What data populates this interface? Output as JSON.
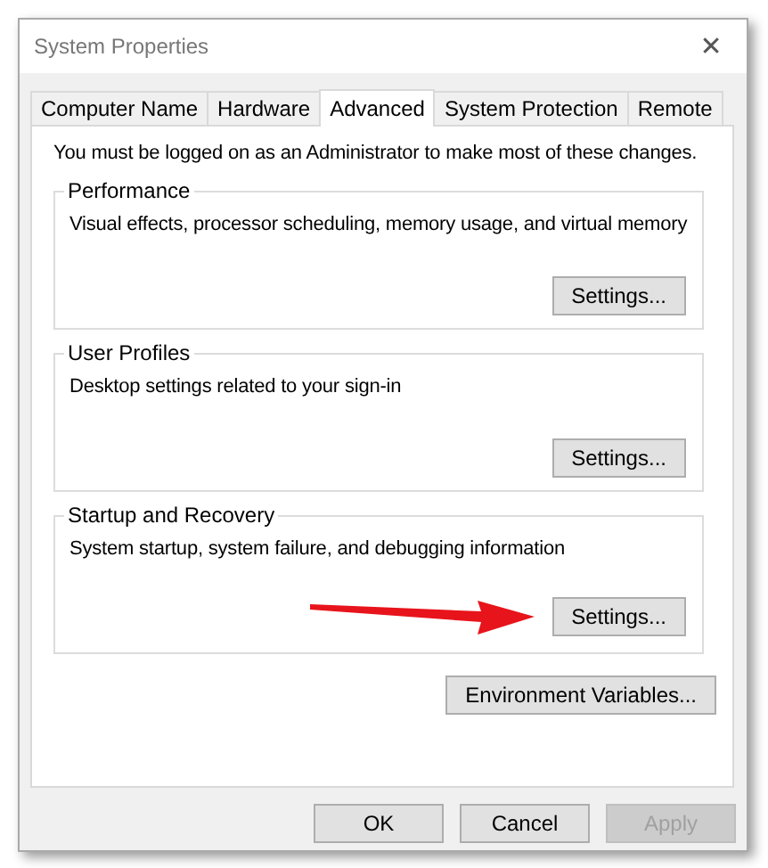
{
  "window": {
    "title": "System Properties",
    "close": "✕"
  },
  "tabs": [
    {
      "label": "Computer Name",
      "selected": false
    },
    {
      "label": "Hardware",
      "selected": false
    },
    {
      "label": "Advanced",
      "selected": true
    },
    {
      "label": "System Protection",
      "selected": false
    },
    {
      "label": "Remote",
      "selected": false
    }
  ],
  "notice": "You must be logged on as an Administrator to make most of these changes.",
  "groups": [
    {
      "title": "Performance",
      "description": "Visual effects, processor scheduling, memory usage, and virtual memory",
      "button": "Settings...",
      "annotated": false
    },
    {
      "title": "User Profiles",
      "description": "Desktop settings related to your sign-in",
      "button": "Settings...",
      "annotated": false
    },
    {
      "title": "Startup and Recovery",
      "description": "System startup, system failure, and debugging information",
      "button": "Settings...",
      "annotated": true
    }
  ],
  "environment_button": "Environment Variables...",
  "buttons": [
    {
      "label": "OK",
      "disabled": false
    },
    {
      "label": "Cancel",
      "disabled": false
    },
    {
      "label": "Apply",
      "disabled": true
    }
  ]
}
